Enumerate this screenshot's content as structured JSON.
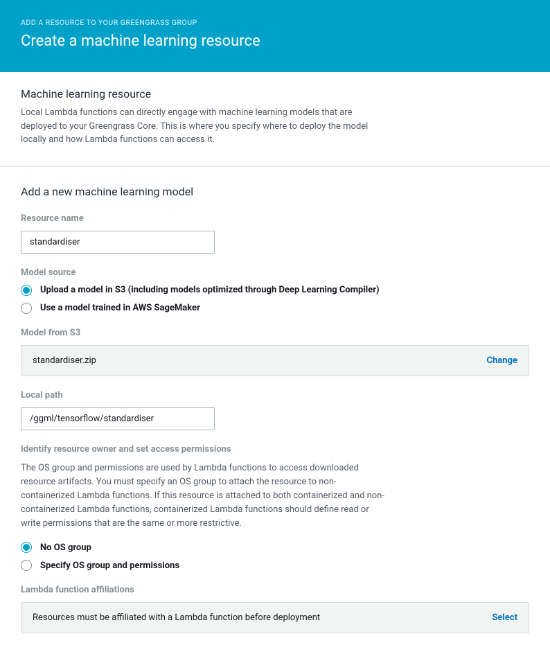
{
  "header": {
    "eyebrow": "ADD A RESOURCE TO YOUR GREENGRASS GROUP",
    "title": "Create a machine learning resource"
  },
  "intro": {
    "title": "Machine learning resource",
    "description": "Local Lambda functions can directly engage with machine learning models that are deployed to your Greengrass Core. This is where you specify where to deploy the model locally and how Lambda functions can access it."
  },
  "form": {
    "title": "Add a new machine learning model",
    "resource_name": {
      "label": "Resource name",
      "value": "standardiser"
    },
    "model_source": {
      "label": "Model source",
      "option_s3": "Upload a model in S3 (including models optimized through Deep Learning Compiler)",
      "option_sagemaker": "Use a model trained in AWS SageMaker"
    },
    "model_from_s3": {
      "label": "Model from S3",
      "value": "standardiser.zip",
      "action": "Change"
    },
    "local_path": {
      "label": "Local path",
      "value": "/ggml/tensorflow/standardiser"
    },
    "permissions": {
      "label": "Identify resource owner and set access permissions",
      "description": "The OS group and permissions are used by Lambda functions to access downloaded resource artifacts. You must specify an OS group to attach the resource to non-containerized Lambda functions. If this resource is attached to both containerized and non-containerized Lambda functions, containerized Lambda functions should define read or write permissions that are the same or more restrictive.",
      "option_no_group": "No OS group",
      "option_specify": "Specify OS group and permissions"
    },
    "lambda_affiliations": {
      "label": "Lambda function affiliations",
      "value": "Resources must be affiliated with a Lambda function before deployment",
      "action": "Select"
    }
  }
}
